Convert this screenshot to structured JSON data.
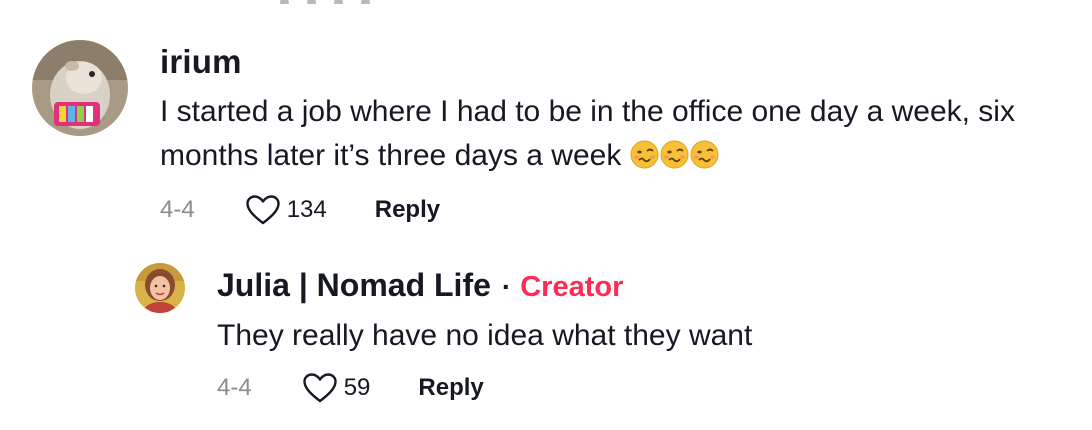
{
  "comment": {
    "username": "irium",
    "text": "I started a job where I had to be in the office one day a week, six months later it’s three days a week",
    "emoji_count": 3,
    "emoji_icon": "woozy-face-emoji",
    "date": "4-4",
    "likes": "134",
    "reply_label": "Reply",
    "avatar_icon": "guinea-pig-avatar"
  },
  "reply": {
    "username": "Julia | Nomad Life",
    "separator": "·",
    "badge": "Creator",
    "text": "They really have no idea what they want",
    "date": "4-4",
    "likes": "59",
    "reply_label": "Reply",
    "avatar_icon": "woman-portrait-avatar"
  },
  "colors": {
    "text": "#161823",
    "muted": "#8a8b91",
    "creator": "#fe2c55",
    "heart_outline": "#161823"
  }
}
